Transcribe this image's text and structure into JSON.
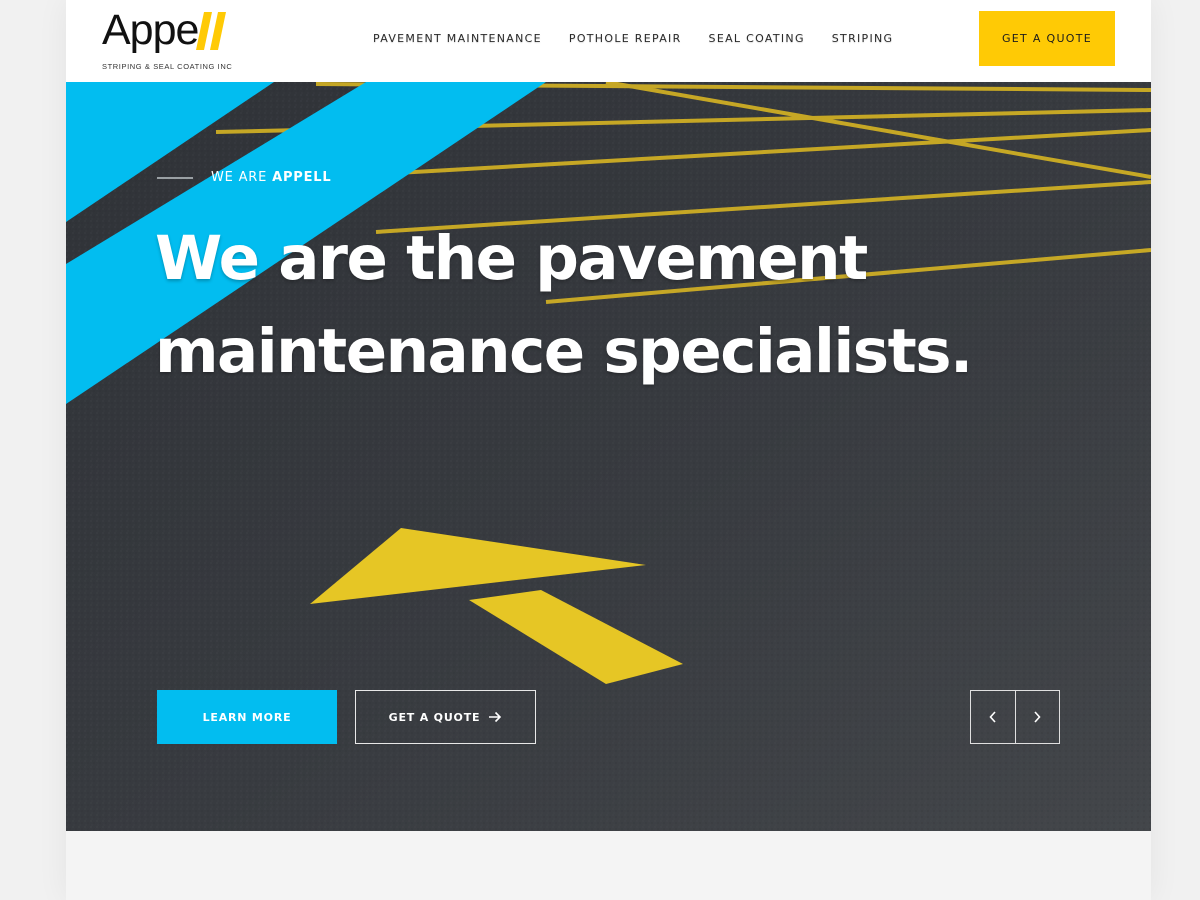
{
  "brand": {
    "name": "Appe",
    "tagline": "STRIPING & SEAL COATING INC",
    "accent": "#ffca05"
  },
  "nav": {
    "items": [
      "PAVEMENT MAINTENANCE",
      "POTHOLE REPAIR",
      "SEAL COATING",
      "STRIPING"
    ],
    "quote_label": "GET A QUOTE"
  },
  "hero": {
    "eyebrow_prefix": "WE ARE ",
    "eyebrow_strong": "APPELL",
    "headline_line1": "We are the pavement",
    "headline_line2": "maintenance specialists.",
    "learn_more": "LEARN MORE",
    "get_quote": "GET A QUOTE",
    "prev_icon": "chevron-left-icon",
    "next_icon": "chevron-right-icon",
    "cta_icon": "arrow-right-icon"
  },
  "colors": {
    "primary": "#02bdf0",
    "yellow": "#ffca05",
    "asphalt": "#33363b"
  }
}
